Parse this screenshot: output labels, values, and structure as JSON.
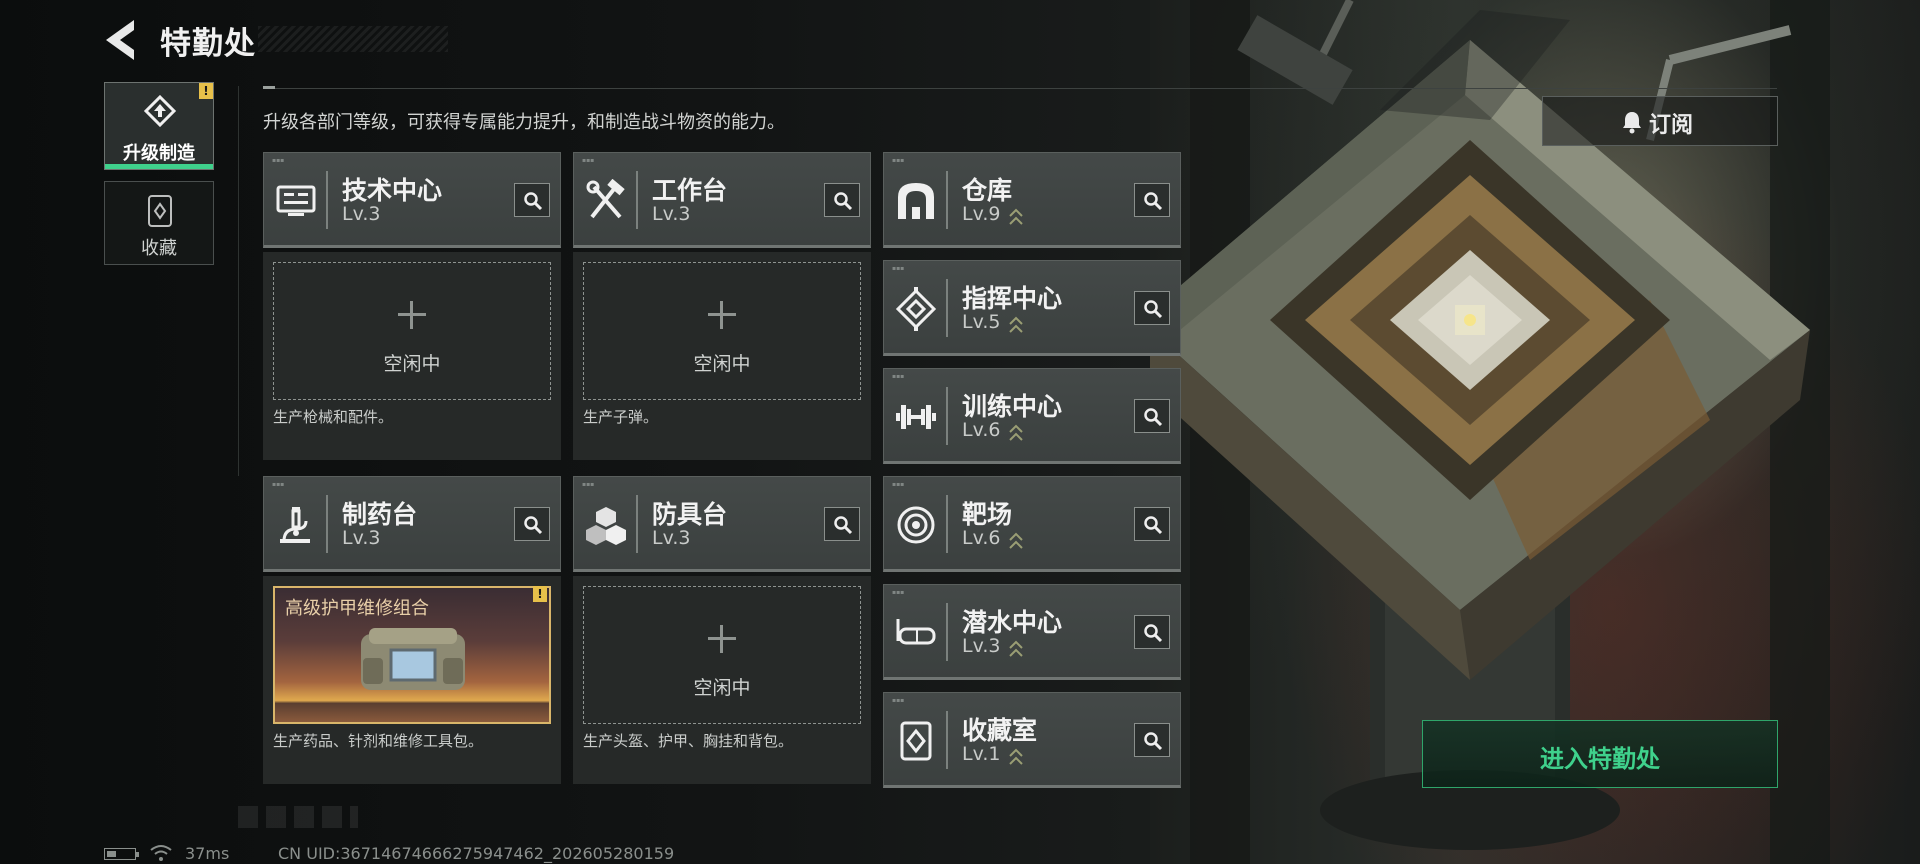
{
  "header": {
    "title": "特勤处",
    "back_icon": "back-arrow-icon"
  },
  "side_tabs": [
    {
      "label": "升级制造",
      "icon": "upgrade-icon",
      "active": true,
      "alert": "!"
    },
    {
      "label": "收藏",
      "icon": "collection-icon",
      "active": false
    }
  ],
  "description": "升级各部门等级，可获得专属能力提升，和制造战斗物资的能力。",
  "subscribe": {
    "label": "订阅",
    "icon": "bell-icon"
  },
  "departments": [
    {
      "name": "技术中心",
      "level": "Lv.3",
      "icon": "tech-center-icon",
      "upgradable": false
    },
    {
      "name": "工作台",
      "level": "Lv.3",
      "icon": "workbench-icon",
      "upgradable": false
    },
    {
      "name": "仓库",
      "level": "Lv.9",
      "icon": "warehouse-icon",
      "upgradable": true
    },
    {
      "name": "指挥中心",
      "level": "Lv.5",
      "icon": "command-center-icon",
      "upgradable": true
    },
    {
      "name": "训练中心",
      "level": "Lv.6",
      "icon": "training-center-icon",
      "upgradable": true
    },
    {
      "name": "制药台",
      "level": "Lv.3",
      "icon": "pharmacy-icon",
      "upgradable": false
    },
    {
      "name": "防具台",
      "level": "Lv.3",
      "icon": "armor-bench-icon",
      "upgradable": false
    },
    {
      "name": "靶场",
      "level": "Lv.6",
      "icon": "shooting-range-icon",
      "upgradable": true
    },
    {
      "name": "潜水中心",
      "level": "Lv.3",
      "icon": "diving-center-icon",
      "upgradable": true
    },
    {
      "name": "收藏室",
      "level": "Lv.1",
      "icon": "collection-room-icon",
      "upgradable": true
    }
  ],
  "production_slots": [
    {
      "status": "空闲中",
      "desc": "生产枪械和配件。"
    },
    {
      "status": "空闲中",
      "desc": "生产子弹。"
    },
    {
      "item_name": "高级护甲维修组合",
      "desc": "生产药品、针剂和维修工具包。",
      "alert": "!"
    },
    {
      "status": "空闲中",
      "desc": "生产头盔、护甲、胸挂和背包。"
    }
  ],
  "enter_button": {
    "label": "进入特勤处"
  },
  "status_bar": {
    "ping": "37ms",
    "uid": "CN UID:3671467466627594746​2_202605280159",
    "battery_level": 0.35
  },
  "colors": {
    "accent_green": "#3fd18c",
    "alert_yellow": "#e7c04a",
    "item_gold": "#d9b66a"
  }
}
